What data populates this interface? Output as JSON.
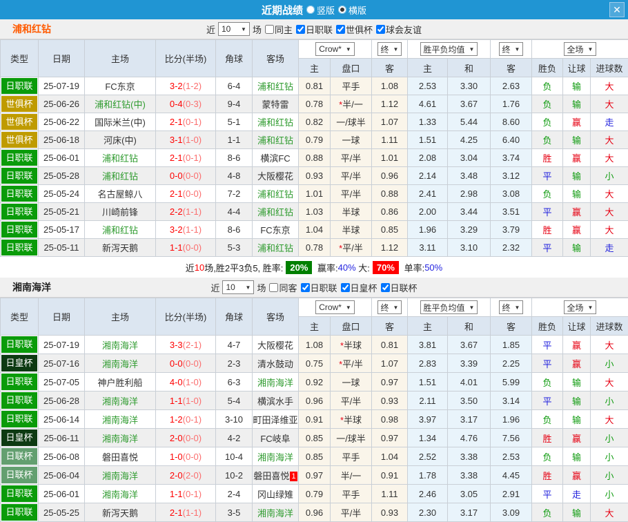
{
  "titlebar": {
    "title": "近期战绩",
    "close_glyph": "✕",
    "layout_options": [
      {
        "label": "竖版",
        "selected": false
      },
      {
        "label": "横版",
        "selected": true
      }
    ]
  },
  "table": {
    "headers": {
      "type": "类型",
      "date": "日期",
      "home": "主场",
      "score": "比分(半场)",
      "corner": "角球",
      "away": "客场",
      "odds_home": "主",
      "odds_handicap": "盘口",
      "odds_away": "客",
      "avg_home": "主",
      "avg_draw": "和",
      "avg_away": "客",
      "result_wdl": "胜负",
      "result_handicap": "让球",
      "result_goals": "进球数"
    },
    "dropdowns": {
      "odds_source": "Crow*",
      "odds_final": "终",
      "avg_source": "胜平负均值",
      "avg_final": "终",
      "scope": "全场"
    }
  },
  "type_colors": {
    "日职联": "#0a9b0a",
    "世俱杯": "#bf9b00",
    "日皇杯": "#0d3a12",
    "日联杯": "#639f70"
  },
  "result_colors": {
    "r": "#e60012",
    "b": "#2020dd",
    "g": "#0f9b0f"
  },
  "sections": [
    {
      "team": "浦和红钻",
      "team_color": "#ff5a00",
      "prefix": "近",
      "count": "10",
      "suffix": "场",
      "checkboxes": [
        {
          "label": "同主",
          "checked": false
        },
        {
          "label": "日职联",
          "checked": true
        },
        {
          "label": "世俱杯",
          "checked": true
        },
        {
          "label": "球会友谊",
          "checked": true
        }
      ],
      "rows": [
        {
          "type": "日职联",
          "date": "25-07-19",
          "home": "FC东京",
          "hg": false,
          "score": "3-2",
          "half": "1-2",
          "corner": "6-4",
          "away": "浦和红钻",
          "ag": true,
          "odds": [
            "0.81",
            "平手",
            "1.08"
          ],
          "avg": [
            "2.53",
            "3.30",
            "2.63"
          ],
          "res": [
            [
              "负",
              "g"
            ],
            [
              "输",
              "g"
            ],
            [
              "大",
              "r"
            ]
          ]
        },
        {
          "type": "世俱杯",
          "date": "25-06-26",
          "home": "浦和红钻(中)",
          "hg": true,
          "score": "0-4",
          "half": "0-3",
          "corner": "9-4",
          "away": "蒙特雷",
          "ag": false,
          "odds": [
            "0.78",
            "*半/一",
            "1.12"
          ],
          "avg": [
            "4.61",
            "3.67",
            "1.76"
          ],
          "res": [
            [
              "负",
              "g"
            ],
            [
              "输",
              "g"
            ],
            [
              "大",
              "r"
            ]
          ]
        },
        {
          "type": "世俱杯",
          "date": "25-06-22",
          "home": "国际米兰(中)",
          "hg": false,
          "score": "2-1",
          "half": "0-1",
          "corner": "5-1",
          "away": "浦和红钻",
          "ag": true,
          "odds": [
            "0.82",
            "一/球半",
            "1.07"
          ],
          "avg": [
            "1.33",
            "5.44",
            "8.60"
          ],
          "res": [
            [
              "负",
              "g"
            ],
            [
              "赢",
              "r"
            ],
            [
              "走",
              "b"
            ]
          ]
        },
        {
          "type": "世俱杯",
          "date": "25-06-18",
          "home": "河床(中)",
          "hg": false,
          "score": "3-1",
          "half": "1-0",
          "corner": "1-1",
          "away": "浦和红钻",
          "ag": true,
          "odds": [
            "0.79",
            "一球",
            "1.11"
          ],
          "avg": [
            "1.51",
            "4.25",
            "6.40"
          ],
          "res": [
            [
              "负",
              "g"
            ],
            [
              "输",
              "g"
            ],
            [
              "大",
              "r"
            ]
          ]
        },
        {
          "type": "日职联",
          "date": "25-06-01",
          "home": "浦和红钻",
          "hg": true,
          "score": "2-1",
          "half": "0-1",
          "corner": "8-6",
          "away": "横滨FC",
          "ag": false,
          "odds": [
            "0.88",
            "平/半",
            "1.01"
          ],
          "avg": [
            "2.08",
            "3.04",
            "3.74"
          ],
          "res": [
            [
              "胜",
              "r"
            ],
            [
              "赢",
              "r"
            ],
            [
              "大",
              "r"
            ]
          ]
        },
        {
          "type": "日职联",
          "date": "25-05-28",
          "home": "浦和红钻",
          "hg": true,
          "score": "0-0",
          "half": "0-0",
          "corner": "4-8",
          "away": "大阪樱花",
          "ag": false,
          "odds": [
            "0.93",
            "平/半",
            "0.96"
          ],
          "avg": [
            "2.14",
            "3.48",
            "3.12"
          ],
          "res": [
            [
              "平",
              "b"
            ],
            [
              "输",
              "g"
            ],
            [
              "小",
              "g"
            ]
          ]
        },
        {
          "type": "日职联",
          "date": "25-05-24",
          "home": "名古屋鲸八",
          "hg": false,
          "score": "2-1",
          "half": "0-0",
          "corner": "7-2",
          "away": "浦和红钻",
          "ag": true,
          "odds": [
            "1.01",
            "平/半",
            "0.88"
          ],
          "avg": [
            "2.41",
            "2.98",
            "3.08"
          ],
          "res": [
            [
              "负",
              "g"
            ],
            [
              "输",
              "g"
            ],
            [
              "大",
              "r"
            ]
          ]
        },
        {
          "type": "日职联",
          "date": "25-05-21",
          "home": "川崎前锋",
          "hg": false,
          "score": "2-2",
          "half": "1-1",
          "corner": "4-4",
          "away": "浦和红钻",
          "ag": true,
          "odds": [
            "1.03",
            "半球",
            "0.86"
          ],
          "avg": [
            "2.00",
            "3.44",
            "3.51"
          ],
          "res": [
            [
              "平",
              "b"
            ],
            [
              "赢",
              "r"
            ],
            [
              "大",
              "r"
            ]
          ]
        },
        {
          "type": "日职联",
          "date": "25-05-17",
          "home": "浦和红钻",
          "hg": true,
          "score": "3-2",
          "half": "1-1",
          "corner": "8-6",
          "away": "FC东京",
          "ag": false,
          "odds": [
            "1.04",
            "半球",
            "0.85"
          ],
          "avg": [
            "1.96",
            "3.29",
            "3.79"
          ],
          "res": [
            [
              "胜",
              "r"
            ],
            [
              "赢",
              "r"
            ],
            [
              "大",
              "r"
            ]
          ]
        },
        {
          "type": "日职联",
          "date": "25-05-11",
          "home": "新泻天鹅",
          "hg": false,
          "score": "1-1",
          "half": "0-0",
          "corner": "5-3",
          "away": "浦和红钻",
          "ag": true,
          "odds": [
            "0.78",
            "*平/半",
            "1.12"
          ],
          "avg": [
            "3.11",
            "3.10",
            "2.32"
          ],
          "res": [
            [
              "平",
              "b"
            ],
            [
              "输",
              "g"
            ],
            [
              "走",
              "b"
            ]
          ]
        }
      ],
      "summary": [
        {
          "text": "近",
          "style": "plain-seg"
        },
        {
          "text": "10",
          "style": "red-seg"
        },
        {
          "text": "场,胜2平3负5, 胜率:",
          "style": "plain-seg"
        },
        {
          "text": "20%",
          "style": "badge-green"
        },
        {
          "text": " 赢率:",
          "style": "plain-seg"
        },
        {
          "text": "40%",
          "style": "blue-seg"
        },
        {
          "text": " 大:",
          "style": "plain-seg"
        },
        {
          "text": "70%",
          "style": "badge-red"
        },
        {
          "text": " 单率:",
          "style": "plain-seg"
        },
        {
          "text": "50%",
          "style": "blue-seg"
        }
      ]
    },
    {
      "team": "湘南海洋",
      "team_color": "#222222",
      "prefix": "近",
      "count": "10",
      "suffix": "场",
      "checkboxes": [
        {
          "label": "同客",
          "checked": false
        },
        {
          "label": "日职联",
          "checked": true
        },
        {
          "label": "日皇杯",
          "checked": true
        },
        {
          "label": "日联杯",
          "checked": true
        }
      ],
      "rows": [
        {
          "type": "日职联",
          "date": "25-07-19",
          "home": "湘南海洋",
          "hg": true,
          "score": "3-3",
          "half": "2-1",
          "corner": "4-7",
          "away": "大阪樱花",
          "ag": false,
          "odds": [
            "1.08",
            "*半球",
            "0.81"
          ],
          "avg": [
            "3.81",
            "3.67",
            "1.85"
          ],
          "res": [
            [
              "平",
              "b"
            ],
            [
              "赢",
              "r"
            ],
            [
              "大",
              "r"
            ]
          ]
        },
        {
          "type": "日皇杯",
          "date": "25-07-16",
          "home": "湘南海洋",
          "hg": true,
          "score": "0-0",
          "half": "0-0",
          "corner": "2-3",
          "away": "清水鼓动",
          "ag": false,
          "odds": [
            "0.75",
            "*平/半",
            "1.07"
          ],
          "avg": [
            "2.83",
            "3.39",
            "2.25"
          ],
          "res": [
            [
              "平",
              "b"
            ],
            [
              "赢",
              "r"
            ],
            [
              "小",
              "g"
            ]
          ]
        },
        {
          "type": "日职联",
          "date": "25-07-05",
          "home": "神户胜利船",
          "hg": false,
          "score": "4-0",
          "half": "1-0",
          "corner": "6-3",
          "away": "湘南海洋",
          "ag": true,
          "odds": [
            "0.92",
            "一球",
            "0.97"
          ],
          "avg": [
            "1.51",
            "4.01",
            "5.99"
          ],
          "res": [
            [
              "负",
              "g"
            ],
            [
              "输",
              "g"
            ],
            [
              "大",
              "r"
            ]
          ]
        },
        {
          "type": "日职联",
          "date": "25-06-28",
          "home": "湘南海洋",
          "hg": true,
          "score": "1-1",
          "half": "1-0",
          "corner": "5-4",
          "away": "横滨水手",
          "ag": false,
          "odds": [
            "0.96",
            "平/半",
            "0.93"
          ],
          "avg": [
            "2.11",
            "3.50",
            "3.14"
          ],
          "res": [
            [
              "平",
              "b"
            ],
            [
              "输",
              "g"
            ],
            [
              "小",
              "g"
            ]
          ]
        },
        {
          "type": "日职联",
          "date": "25-06-14",
          "home": "湘南海洋",
          "hg": true,
          "score": "1-2",
          "half": "0-1",
          "corner": "3-10",
          "away": "町田泽维亚",
          "ag": false,
          "odds": [
            "0.91",
            "*半球",
            "0.98"
          ],
          "avg": [
            "3.97",
            "3.17",
            "1.96"
          ],
          "res": [
            [
              "负",
              "g"
            ],
            [
              "输",
              "g"
            ],
            [
              "大",
              "r"
            ]
          ]
        },
        {
          "type": "日皇杯",
          "date": "25-06-11",
          "home": "湘南海洋",
          "hg": true,
          "score": "2-0",
          "half": "0-0",
          "corner": "4-2",
          "away": "FC岐阜",
          "ag": false,
          "odds": [
            "0.85",
            "一/球半",
            "0.97"
          ],
          "avg": [
            "1.34",
            "4.76",
            "7.56"
          ],
          "res": [
            [
              "胜",
              "r"
            ],
            [
              "赢",
              "r"
            ],
            [
              "小",
              "g"
            ]
          ]
        },
        {
          "type": "日联杯",
          "date": "25-06-08",
          "home": "磐田喜悦",
          "hg": false,
          "score": "1-0",
          "half": "0-0",
          "corner": "10-4",
          "away": "湘南海洋",
          "ag": true,
          "odds": [
            "0.85",
            "平手",
            "1.04"
          ],
          "avg": [
            "2.52",
            "3.38",
            "2.53"
          ],
          "res": [
            [
              "负",
              "g"
            ],
            [
              "输",
              "g"
            ],
            [
              "小",
              "g"
            ]
          ]
        },
        {
          "type": "日联杯",
          "date": "25-06-04",
          "home": "湘南海洋",
          "hg": true,
          "score": "2-0",
          "half": "2-0",
          "corner": "10-2",
          "away": "磐田喜悦",
          "ag": false,
          "sup": "1",
          "odds": [
            "0.97",
            "半/一",
            "0.91"
          ],
          "avg": [
            "1.78",
            "3.38",
            "4.45"
          ],
          "res": [
            [
              "胜",
              "r"
            ],
            [
              "赢",
              "r"
            ],
            [
              "小",
              "g"
            ]
          ]
        },
        {
          "type": "日职联",
          "date": "25-06-01",
          "home": "湘南海洋",
          "hg": true,
          "score": "1-1",
          "half": "0-1",
          "corner": "2-4",
          "away": "冈山绿雉",
          "ag": false,
          "odds": [
            "0.79",
            "平手",
            "1.11"
          ],
          "avg": [
            "2.46",
            "3.05",
            "2.91"
          ],
          "res": [
            [
              "平",
              "b"
            ],
            [
              "走",
              "b"
            ],
            [
              "小",
              "g"
            ]
          ]
        },
        {
          "type": "日职联",
          "date": "25-05-25",
          "home": "新泻天鹅",
          "hg": false,
          "score": "2-1",
          "half": "1-1",
          "corner": "3-5",
          "away": "湘南海洋",
          "ag": true,
          "odds": [
            "0.96",
            "平/半",
            "0.93"
          ],
          "avg": [
            "2.30",
            "3.17",
            "3.09"
          ],
          "res": [
            [
              "负",
              "g"
            ],
            [
              "输",
              "g"
            ],
            [
              "大",
              "r"
            ]
          ]
        }
      ],
      "summary": []
    }
  ]
}
